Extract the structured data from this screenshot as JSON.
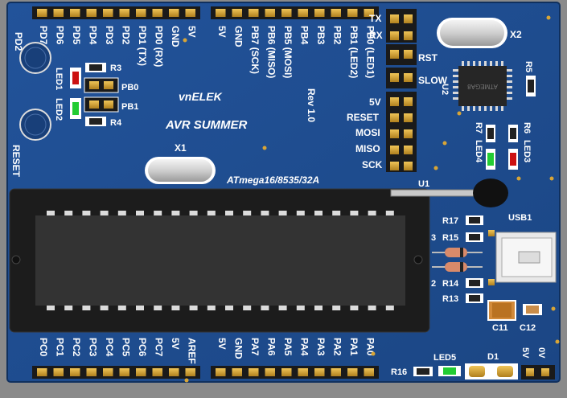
{
  "board": {
    "brand": "vnELEK",
    "title": "AVR SUMMER",
    "revision": "Rev 1.0",
    "chip_label": "ATmega16/8535/32A",
    "small_chip_label": "ATMEGA8"
  },
  "colors": {
    "pcb": "#1f4c8f",
    "pcb_dark": "#173c73",
    "silk": "#ffffff",
    "gold": "#d7a332",
    "socket": "#1a1a1a",
    "chip": "#2d2d2d"
  },
  "top_left_pins": [
    "PD7",
    "PD6",
    "PD5",
    "PD4",
    "PD3",
    "PD2",
    "PD1 (TX)",
    "PD0 (RX)",
    "GND",
    "5V"
  ],
  "top_right_pins": [
    "5V",
    "GND",
    "PB7 (SCK)",
    "PB6 (MISO)",
    "PB5 (MOSI)",
    "PB4",
    "PB3",
    "PB2",
    "PB1 (LED2)",
    "PB0 (LED1)"
  ],
  "bottom_left_pins": [
    "PC0",
    "PC1",
    "PC2",
    "PC3",
    "PC4",
    "PC5",
    "PC6",
    "PC7",
    "5V",
    "AREF"
  ],
  "bottom_right_pins": [
    "5V",
    "GND",
    "PA7",
    "PA6",
    "PA5",
    "PA4",
    "PA3",
    "PA2",
    "PA1",
    "PA0"
  ],
  "right_header_labels": {
    "tx": "TX",
    "rx": "RX",
    "rst": "RST",
    "slow": "SLOW",
    "v5": "5V",
    "reset": "RESET",
    "mosi": "MOSI",
    "miso": "MISO",
    "sck": "SCK"
  },
  "labels": {
    "pd2": "PD2",
    "reset_btn": "RESET",
    "led1": "LED1",
    "led2": "LED2",
    "r3": "R3",
    "r4": "R4",
    "pb0": "PB0",
    "pb1": "PB1",
    "x1": "X1",
    "x2": "X2",
    "u1": "U1",
    "u2": "U2",
    "r5": "R5",
    "r6": "R6",
    "r7": "R7",
    "led3": "LED3",
    "led4": "LED4",
    "r17": "R17",
    "r15": "R15",
    "r14": "R14",
    "r13": "R13",
    "usb1": "USB1",
    "c11": "C11",
    "c12": "C12",
    "r16": "R16",
    "led5": "LED5",
    "d1": "D1",
    "v5_b": "5V",
    "zero_v": "0V",
    "num3": "3",
    "num2": "2"
  }
}
